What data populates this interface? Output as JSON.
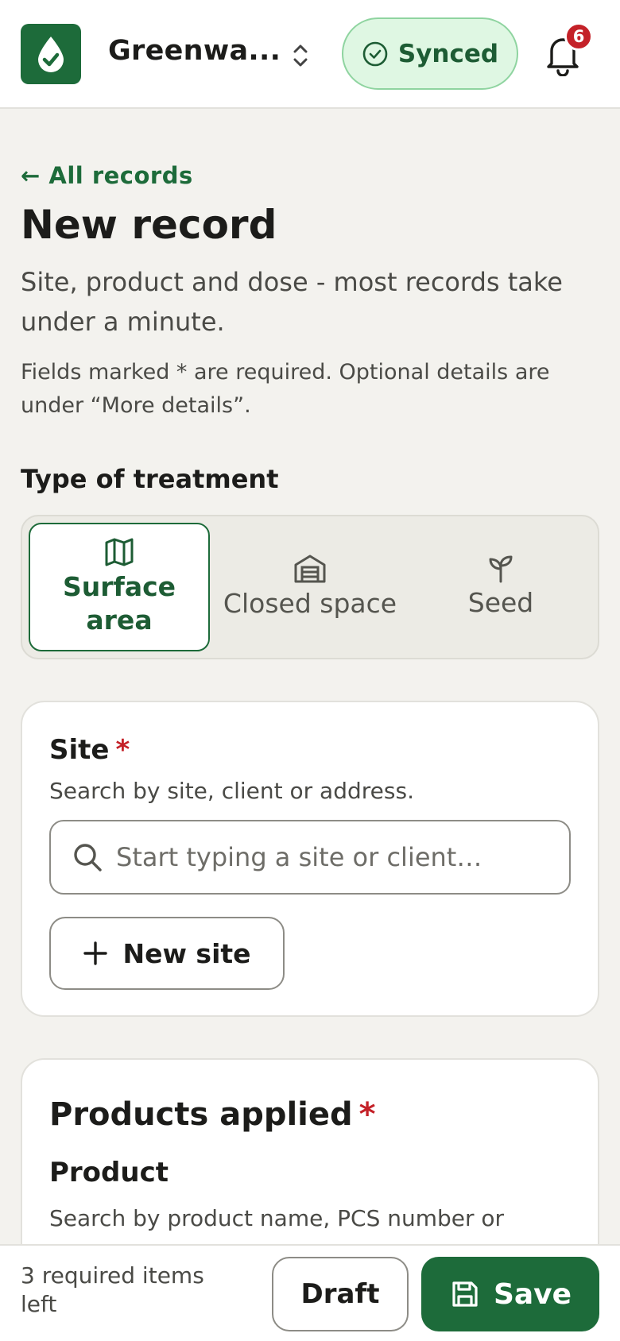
{
  "header": {
    "org_name": "Greenwa...",
    "sync_label": "Synced",
    "notification_count": "6"
  },
  "intro": {
    "back_link": "← All records",
    "title": "New record",
    "subtitle": "Site, product and dose - most records take under a minute.",
    "hint": "Fields marked * are required. Optional details are under “More details”."
  },
  "treatment": {
    "label": "Type of treatment",
    "options": [
      {
        "label": "Surface area",
        "icon": "map-icon",
        "selected": true
      },
      {
        "label": "Closed space",
        "icon": "warehouse-icon",
        "selected": false
      },
      {
        "label": "Seed",
        "icon": "sprout-icon",
        "selected": false
      }
    ]
  },
  "site": {
    "title": "Site",
    "required_mark": "*",
    "help": "Search by site, client or address.",
    "placeholder": "Start typing a site or client…",
    "new_site_label": "New site"
  },
  "products": {
    "title": "Products applied",
    "required_mark": "*",
    "product_label": "Product",
    "product_help": "Search by product name, PCS number or active substance. To begin a add a product."
  },
  "footer": {
    "required_left": "3 required items left",
    "draft_label": "Draft",
    "save_label": "Save"
  },
  "colors": {
    "brand_green": "#1d6b3a",
    "synced_bg": "#dff7e3",
    "required_red": "#c42128",
    "page_bg": "#f3f2ee"
  }
}
